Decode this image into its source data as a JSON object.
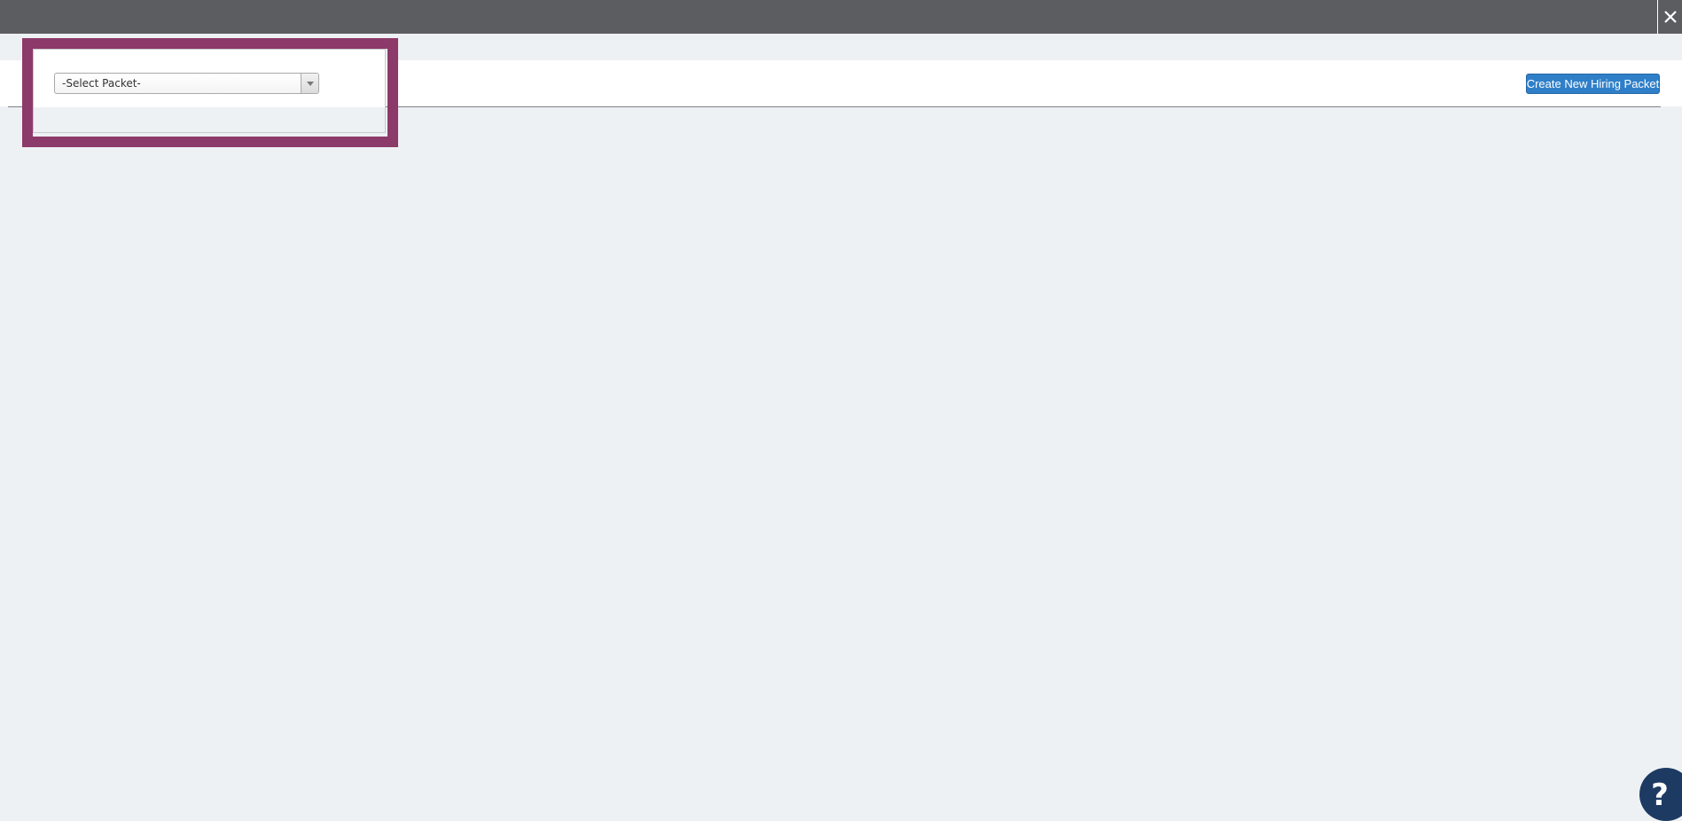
{
  "header": {
    "close_icon": "close-icon"
  },
  "toolbar": {
    "packet_select": {
      "selected": "-Select Packet-",
      "arrow_icon": "chevron-down-icon"
    },
    "create_button_label": "Create New Hiring Packet"
  },
  "help": {
    "glyph": "?",
    "icon": "help-icon"
  },
  "colors": {
    "topbar": "#5c5d60",
    "highlight": "#8c3a6a",
    "primary": "#2f7fc8",
    "help": "#1d3a63",
    "background": "#eef1f4"
  }
}
